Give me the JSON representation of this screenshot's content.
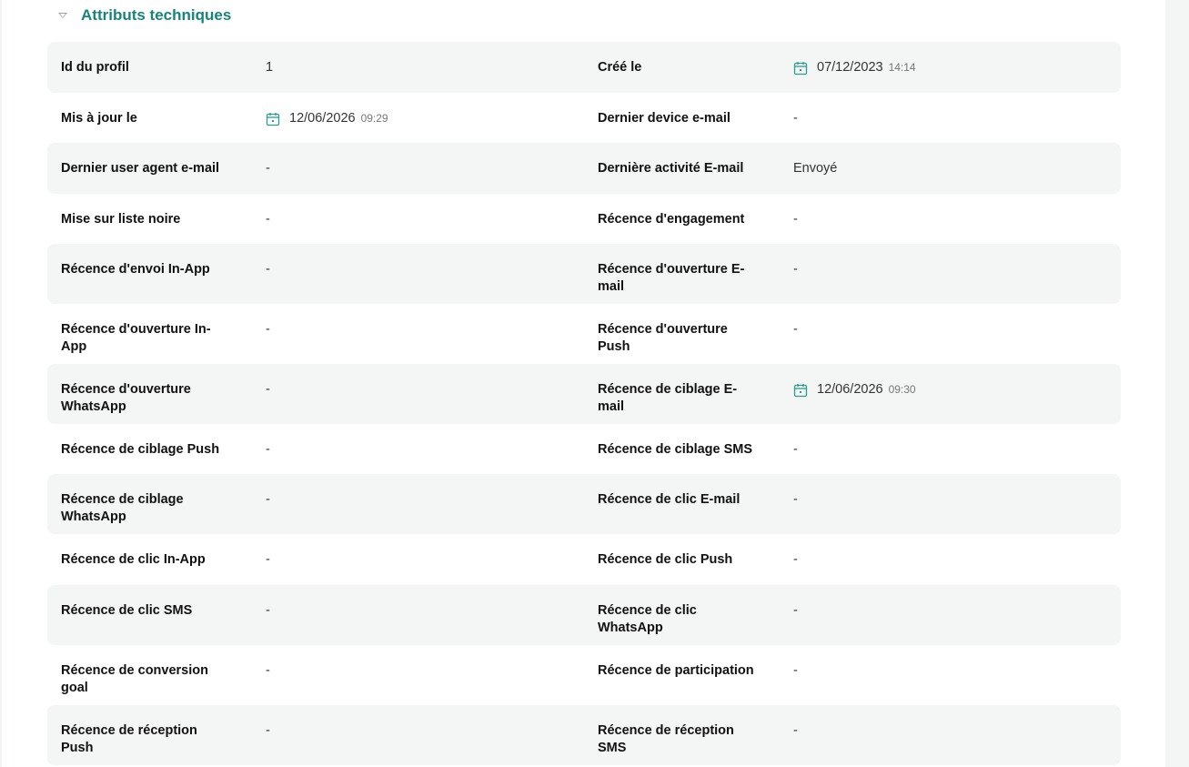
{
  "section": {
    "title": "Attributs techniques",
    "accent_color": "#15847a"
  },
  "rows": [
    {
      "shaded": true,
      "h": 56,
      "l1": "Id du profil",
      "v1": {
        "text": "1"
      },
      "l2": "Créé le",
      "v2": {
        "date": "07/12/2023",
        "time": "14:14"
      }
    },
    {
      "shaded": false,
      "h": 55,
      "l1": "Mis à jour le",
      "v1": {
        "date": "12/06/2026",
        "time": "09:29"
      },
      "l2": "Dernier device e-mail",
      "v2": {
        "text": "-"
      }
    },
    {
      "shaded": true,
      "h": 56,
      "l1": "Dernier user agent e-mail",
      "v1": {
        "text": "-"
      },
      "l2": "Dernière activité E-mail",
      "v2": {
        "text": "Envoyé"
      }
    },
    {
      "shaded": false,
      "h": 55,
      "l1": "Mise sur liste noire",
      "v1": {
        "text": "-"
      },
      "l2": "Récence d'engagement",
      "v2": {
        "text": "-"
      }
    },
    {
      "shaded": true,
      "h": 66,
      "l1": "Récence d'envoi In-App",
      "v1": {
        "text": "-"
      },
      "l2": "Récence d'ouverture E-mail",
      "v2": {
        "text": "-"
      }
    },
    {
      "shaded": false,
      "h": 66,
      "l1": "Récence d'ouverture In-App",
      "v1": {
        "text": "-"
      },
      "l2": "Récence d'ouverture Push",
      "v2": {
        "text": "-"
      }
    },
    {
      "shaded": true,
      "h": 66,
      "l1": "Récence d'ouverture WhatsApp",
      "v1": {
        "text": "-"
      },
      "l2": "Récence de ciblage E-mail",
      "v2": {
        "date": "12/06/2026",
        "time": "09:30"
      }
    },
    {
      "shaded": false,
      "h": 55,
      "l1": "Récence de ciblage Push",
      "v1": {
        "text": "-"
      },
      "l2": "Récence de ciblage SMS",
      "v2": {
        "text": "-"
      }
    },
    {
      "shaded": true,
      "h": 66,
      "l1": "Récence de ciblage WhatsApp",
      "v1": {
        "text": "-"
      },
      "l2": "Récence de clic E-mail",
      "v2": {
        "text": "-"
      }
    },
    {
      "shaded": false,
      "h": 56,
      "l1": "Récence de clic In-App",
      "v1": {
        "text": "-"
      },
      "l2": "Récence de clic Push",
      "v2": {
        "text": "-"
      }
    },
    {
      "shaded": true,
      "h": 66,
      "l1": "Récence de clic SMS",
      "v1": {
        "text": "-"
      },
      "l2": "Récence de clic WhatsApp",
      "v2": {
        "text": "-"
      }
    },
    {
      "shaded": false,
      "h": 66,
      "l1": "Récence de conversion goal",
      "v1": {
        "text": "-"
      },
      "l2": "Récence de participation",
      "v2": {
        "text": "-"
      }
    },
    {
      "shaded": true,
      "h": 66,
      "l1": "Récence de réception Push",
      "v1": {
        "text": "-"
      },
      "l2": "Récence de réception SMS",
      "v2": {
        "text": "-"
      }
    }
  ]
}
